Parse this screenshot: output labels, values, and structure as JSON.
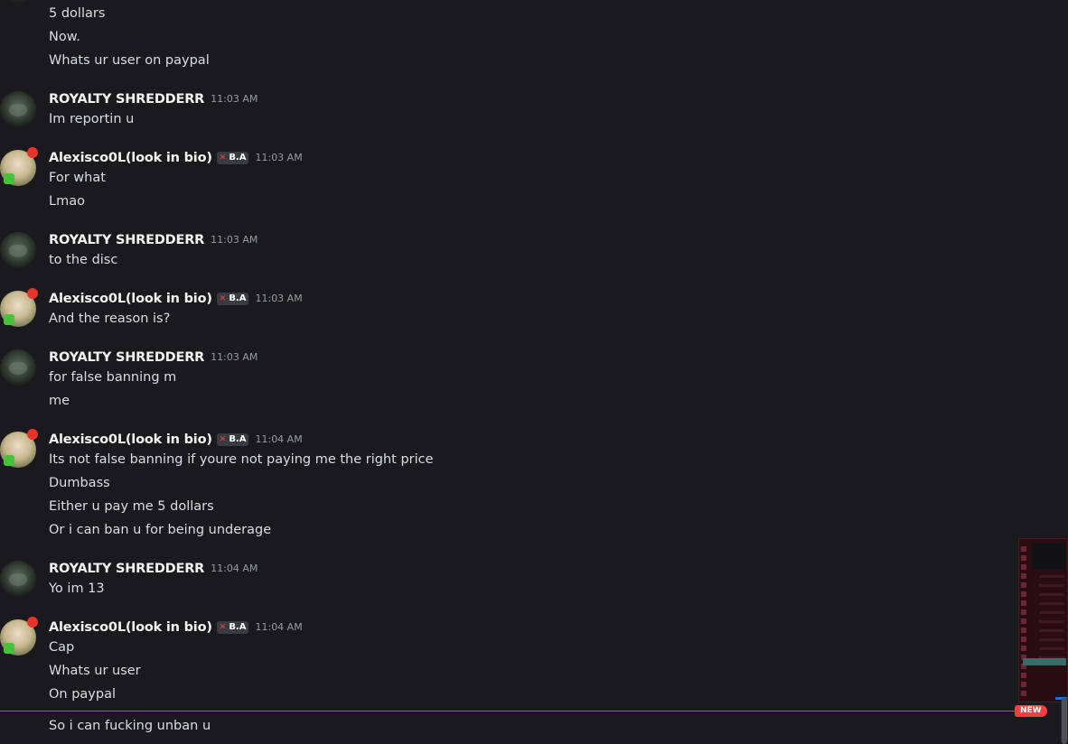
{
  "messages": [
    {
      "user": "",
      "lines": [
        "5 dollars",
        "Now.",
        "Whats ur user on paypal"
      ]
    },
    {
      "user": "ROYALTY SHREDDERR",
      "time": "11:03 AM",
      "lines": [
        "Im reportin u"
      ]
    },
    {
      "user": "Alexisco0L(look in bio)",
      "badge": "B.A",
      "time": "11:03 AM",
      "lines": [
        "For what",
        "Lmao"
      ]
    },
    {
      "user": "ROYALTY SHREDDERR",
      "time": "11:03 AM",
      "lines": [
        "to the disc"
      ]
    },
    {
      "user": "Alexisco0L(look in bio)",
      "badge": "B.A",
      "time": "11:03 AM",
      "lines": [
        "And the reason is?"
      ]
    },
    {
      "user": "ROYALTY SHREDDERR",
      "time": "11:03 AM",
      "lines": [
        "for false banning m",
        "me"
      ]
    },
    {
      "user": "Alexisco0L(look in bio)",
      "badge": "B.A",
      "time": "11:04 AM",
      "lines": [
        "Its not false banning if youre not paying me the right price",
        "Dumbass",
        "Either u pay me 5 dollars",
        "Or i can ban u for being underage"
      ]
    },
    {
      "user": "ROYALTY SHREDDERR",
      "time": "11:04 AM",
      "lines": [
        "Yo im 13"
      ]
    },
    {
      "user": "Alexisco0L(look in bio)",
      "badge": "B.A",
      "time": "11:04 AM",
      "lines": [
        "Cap",
        "Whats ur user",
        "On paypal",
        "So i can fucking unban u"
      ]
    }
  ],
  "new_divider_label": "NEW",
  "colors": {
    "accent_red": "#f23f43",
    "background": "#1a1a1e",
    "text": "#dbdee1",
    "timestamp": "#949ba4"
  },
  "icons": {
    "badge_icon": "sword-icon"
  }
}
